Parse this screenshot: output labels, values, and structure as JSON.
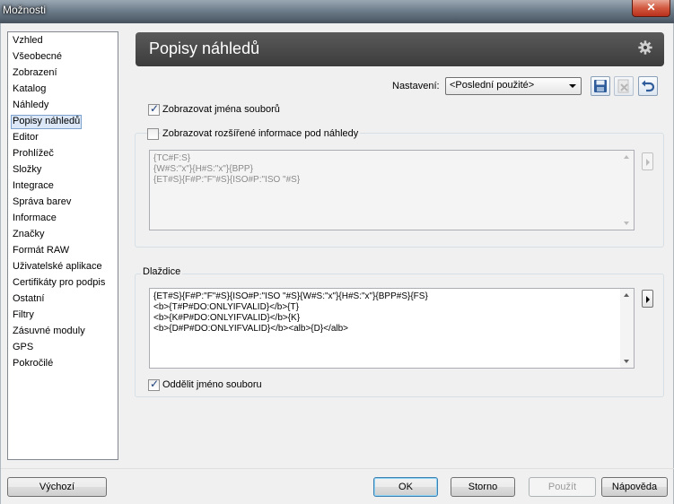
{
  "window": {
    "title": "Možnosti",
    "close_symbol": "✕"
  },
  "sidebar": {
    "items": [
      {
        "label": "Vzhled"
      },
      {
        "label": "Všeobecné"
      },
      {
        "label": "Zobrazení"
      },
      {
        "label": "Katalog"
      },
      {
        "label": "Náhledy"
      },
      {
        "label": "Popisy náhledů",
        "selected": true
      },
      {
        "label": "Editor"
      },
      {
        "label": "Prohlížeč"
      },
      {
        "label": "Složky"
      },
      {
        "label": "Integrace"
      },
      {
        "label": "Správa barev"
      },
      {
        "label": "Informace"
      },
      {
        "label": "Značky"
      },
      {
        "label": "Formát RAW"
      },
      {
        "label": "Uživatelské aplikace"
      },
      {
        "label": "Certifikáty pro podpis"
      },
      {
        "label": "Ostatní"
      },
      {
        "label": "Filtry"
      },
      {
        "label": "Zásuvné moduly"
      },
      {
        "label": "GPS"
      },
      {
        "label": "Pokročilé"
      }
    ]
  },
  "header": {
    "title": "Popisy náhledů",
    "settings_icon": "gear-icon"
  },
  "settings": {
    "label": "Nastavení:",
    "selected": "<Poslední použité>",
    "icons": [
      "save-icon",
      "delete-icon",
      "undo-icon"
    ]
  },
  "show_filenames": {
    "label": "Zobrazovat jména souborů",
    "checked": true
  },
  "extended_info": {
    "label": "Zobrazovat rozšířené informace pod náhledy",
    "checked": false,
    "lines": [
      "{TC#F:S}",
      "{W#S:\"x\"}{H#S:\"x\"}{BPP}",
      "{ET#S}{F#P:\"F\"#S}{ISO#P:\"ISO \"#S}"
    ]
  },
  "tiles": {
    "legend": "Dlaždice",
    "lines": [
      "{ET#S}{F#P:\"F\"#S}{ISO#P:\"ISO \"#S}{W#S:\"x\"}{H#S:\"x\"}{BPP#S}{FS}",
      "<b>{T#P#DO:ONLYIFVALID}</b>{T}",
      "<b>{K#P#DO:ONLYIFVALID}</b>{K}",
      "<b>{D#P#DO:ONLYIFVALID}</b><alb>{D}</alb>"
    ],
    "separate_filename": {
      "label": "Oddělit jméno souboru",
      "checked": true
    }
  },
  "buttons": {
    "default": "Výchozí",
    "ok": "OK",
    "cancel": "Storno",
    "apply": "Použít",
    "help": "Nápověda"
  },
  "colors": {
    "banner": "#3c3c3c",
    "selection": "#dce8f7",
    "default_button_border": "#3c7fb1"
  }
}
